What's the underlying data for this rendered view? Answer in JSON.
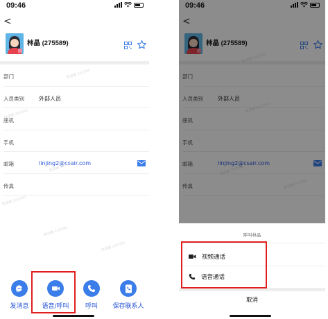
{
  "status_bar": {
    "time": "09:46"
  },
  "nav": {
    "back_glyph": "<"
  },
  "profile": {
    "name": "林晶 (275589)"
  },
  "fields": [
    {
      "label": "部门",
      "value": ""
    },
    {
      "label": "人员类别",
      "value": "外部人员"
    },
    {
      "label": "座机",
      "value": ""
    },
    {
      "label": "手机",
      "value": ""
    },
    {
      "label": "邮箱",
      "value": "linjing2@csair.com"
    },
    {
      "label": "传真",
      "value": ""
    }
  ],
  "watermark_text": "常润德 243590",
  "actions": [
    {
      "label": "发消息",
      "icon": "chat-bubble-icon"
    },
    {
      "label": "语音/呼叫",
      "icon": "video-call-icon"
    },
    {
      "label": "呼叫",
      "icon": "phone-icon"
    },
    {
      "label": "保存联系人",
      "icon": "contact-card-icon"
    }
  ],
  "call_sheet": {
    "title": "呼叫林晶",
    "options": [
      {
        "label": "视频通话",
        "icon": "video-camera-icon"
      },
      {
        "label": "语音通话",
        "icon": "phone-handset-icon"
      }
    ],
    "cancel": "取消"
  },
  "colors": {
    "accent": "#3b7de9",
    "link": "#2453d8",
    "highlight": "#e02020",
    "overlay": "rgba(0,0,0,0.45)"
  }
}
